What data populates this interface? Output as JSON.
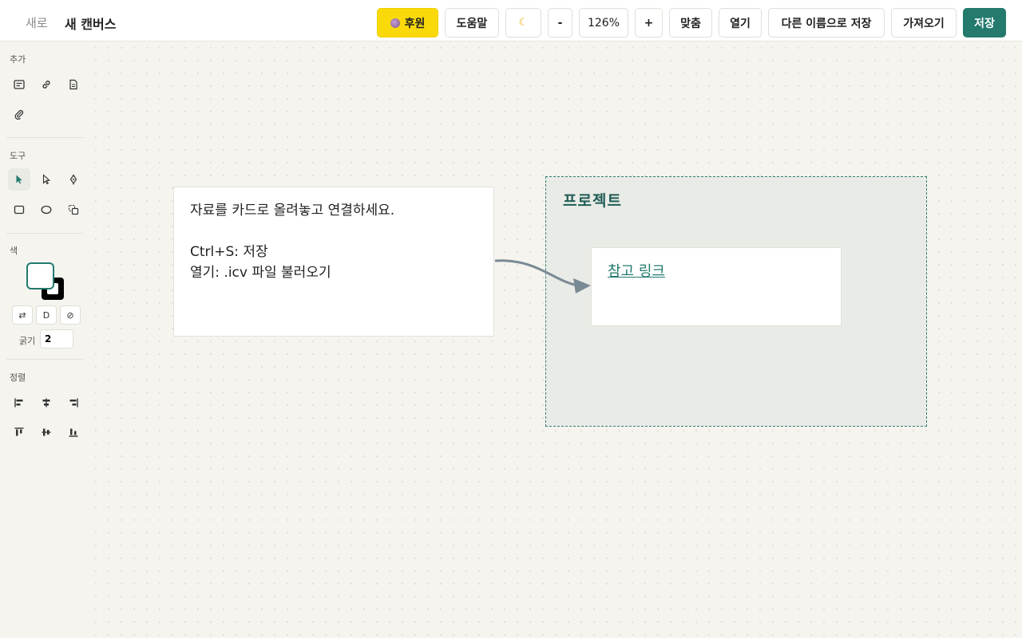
{
  "header": {
    "new_label": "새로",
    "title": "새 캔버스",
    "sponsor_label": "후원",
    "help_label": "도움말",
    "zoom_out_label": "-",
    "zoom_level": "126%",
    "zoom_in_label": "+",
    "fit_label": "맞춤",
    "open_label": "열기",
    "save_as_label": "다른 이름으로 저장",
    "import_label": "가져오기",
    "save_label": "저장"
  },
  "sidebar": {
    "add_label": "추가",
    "tools_label": "도구",
    "color_label": "색",
    "swap_label": "⇄",
    "default_label": "D",
    "none_label": "⊘",
    "thickness_label": "굵기",
    "thickness_value": "2",
    "align_label": "정렬"
  },
  "canvas": {
    "note_card": {
      "line1": "자료를 카드로 올려놓고 연결하세요.",
      "line2": "Ctrl+S: 저장",
      "line3": "열기: .icv 파일 불러오기"
    },
    "group": {
      "title": "프로젝트"
    },
    "link_card": {
      "text": "참고 링크"
    }
  },
  "colors": {
    "accent": "#237a6d",
    "sponsor": "#f9d90a",
    "edge": "#7a8a94"
  },
  "icons": {
    "add": [
      "text-card-icon",
      "link-icon",
      "document-icon",
      "attachment-icon"
    ],
    "tools": [
      "select-arrow-icon",
      "direct-select-icon",
      "pen-tool-icon",
      "rectangle-icon",
      "ellipse-icon",
      "group-icon"
    ],
    "align": [
      "align-left-icon",
      "align-center-horizontal-icon",
      "align-right-icon",
      "align-top-icon",
      "align-middle-icon",
      "align-bottom-icon"
    ]
  }
}
